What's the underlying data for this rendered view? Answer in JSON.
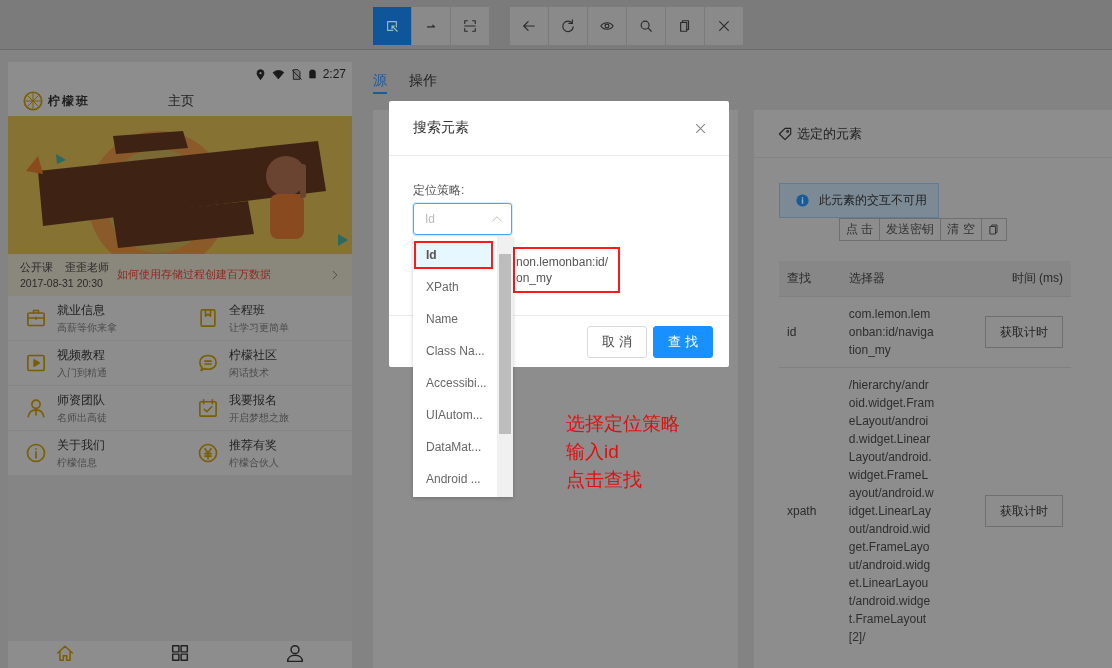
{
  "toolbar": {
    "groups": [
      {
        "buttons": [
          {
            "kind": "pointer",
            "selected": true
          },
          {
            "kind": "arrow",
            "selected": false
          },
          {
            "kind": "expand",
            "selected": false
          }
        ]
      },
      {
        "buttons": [
          {
            "kind": "back",
            "selected": false
          },
          {
            "kind": "refresh",
            "selected": false
          },
          {
            "kind": "eye",
            "selected": false
          },
          {
            "kind": "search",
            "selected": false
          },
          {
            "kind": "copy",
            "selected": false
          },
          {
            "kind": "close",
            "selected": false
          }
        ]
      }
    ]
  },
  "phone": {
    "status_time": "2:27",
    "brand": "柠檬班",
    "title": "主页",
    "course": {
      "tag": "公开课",
      "teacher": "歪歪老师",
      "time": "2017-08-31 20:30",
      "headline": "如何使用存储过程创建百万数据"
    },
    "menu": [
      {
        "kind": "briefcase",
        "title": "就业信息",
        "subtitle": "高薪等你来拿"
      },
      {
        "kind": "bookmark",
        "title": "全程班",
        "subtitle": "让学习更简单"
      },
      {
        "kind": "play",
        "title": "视频教程",
        "subtitle": "入门到精通"
      },
      {
        "kind": "chat",
        "title": "柠檬社区",
        "subtitle": "闲话技术"
      },
      {
        "kind": "person",
        "title": "师资团队",
        "subtitle": "名师出高徒"
      },
      {
        "kind": "calendar",
        "title": "我要报名",
        "subtitle": "开启梦想之旅"
      },
      {
        "kind": "info",
        "title": "关于我们",
        "subtitle": "柠檬信息"
      },
      {
        "kind": "yen",
        "title": "推荐有奖",
        "subtitle": "柠檬合伙人"
      }
    ],
    "nav": [
      {
        "kind": "home",
        "selected": true
      },
      {
        "kind": "grid",
        "selected": false
      },
      {
        "kind": "person",
        "selected": false
      }
    ]
  },
  "tabs": [
    {
      "label": "源",
      "selected": true
    },
    {
      "label": "操作",
      "selected": false
    }
  ],
  "selected_element": {
    "title": "选定的元素",
    "alert": "此元素的交互不可用",
    "actions": [
      {
        "kind": "text",
        "label": "点 击"
      },
      {
        "kind": "text",
        "label": "发送密钥"
      },
      {
        "kind": "text",
        "label": "清 空"
      },
      {
        "kind": "copy"
      }
    ],
    "table": {
      "columns": [
        "查找",
        "选择器",
        "时间 (ms)"
      ],
      "rows": [
        {
          "find": "id",
          "selector": "com.lemon.lemonban:id/navigation_my",
          "action": "获取计时"
        },
        {
          "find": "xpath",
          "selector": "/hierarchy/android.widget.FrameLayout/android.widget.LinearLayout/android.widget.FrameLayout/android.widget.LinearLayout/android.widget.FrameLayout/android.widget.LinearLayout/android.widget.FrameLayout[2]/",
          "action": "获取计时"
        }
      ]
    }
  },
  "dialog": {
    "title": "搜索元素",
    "strategy_label": "定位策略:",
    "strategy": {
      "placeholder": "Id",
      "expanded": true
    },
    "selector_field": {
      "lines": [
        "non.lemonban:id/",
        "on_my"
      ],
      "highlighted": true
    },
    "buttons": [
      {
        "label": "取 消",
        "primary": false
      },
      {
        "label": "查 找",
        "primary": true
      }
    ],
    "options": [
      {
        "label": "Id",
        "selected": true,
        "highlighted": true
      },
      {
        "label": "XPath",
        "selected": false,
        "highlighted": false
      },
      {
        "label": "Name",
        "selected": false,
        "highlighted": false
      },
      {
        "label": "Class Na...",
        "selected": false,
        "highlighted": false
      },
      {
        "label": "Accessibi...",
        "selected": false,
        "highlighted": false
      },
      {
        "label": "UIAutom...",
        "selected": false,
        "highlighted": false
      },
      {
        "label": "DataMat...",
        "selected": false,
        "highlighted": false
      },
      {
        "label": "Android ...",
        "selected": false,
        "highlighted": false
      }
    ]
  },
  "annotation_lines": [
    "选择定位策略",
    "输入id",
    "点击查找"
  ]
}
